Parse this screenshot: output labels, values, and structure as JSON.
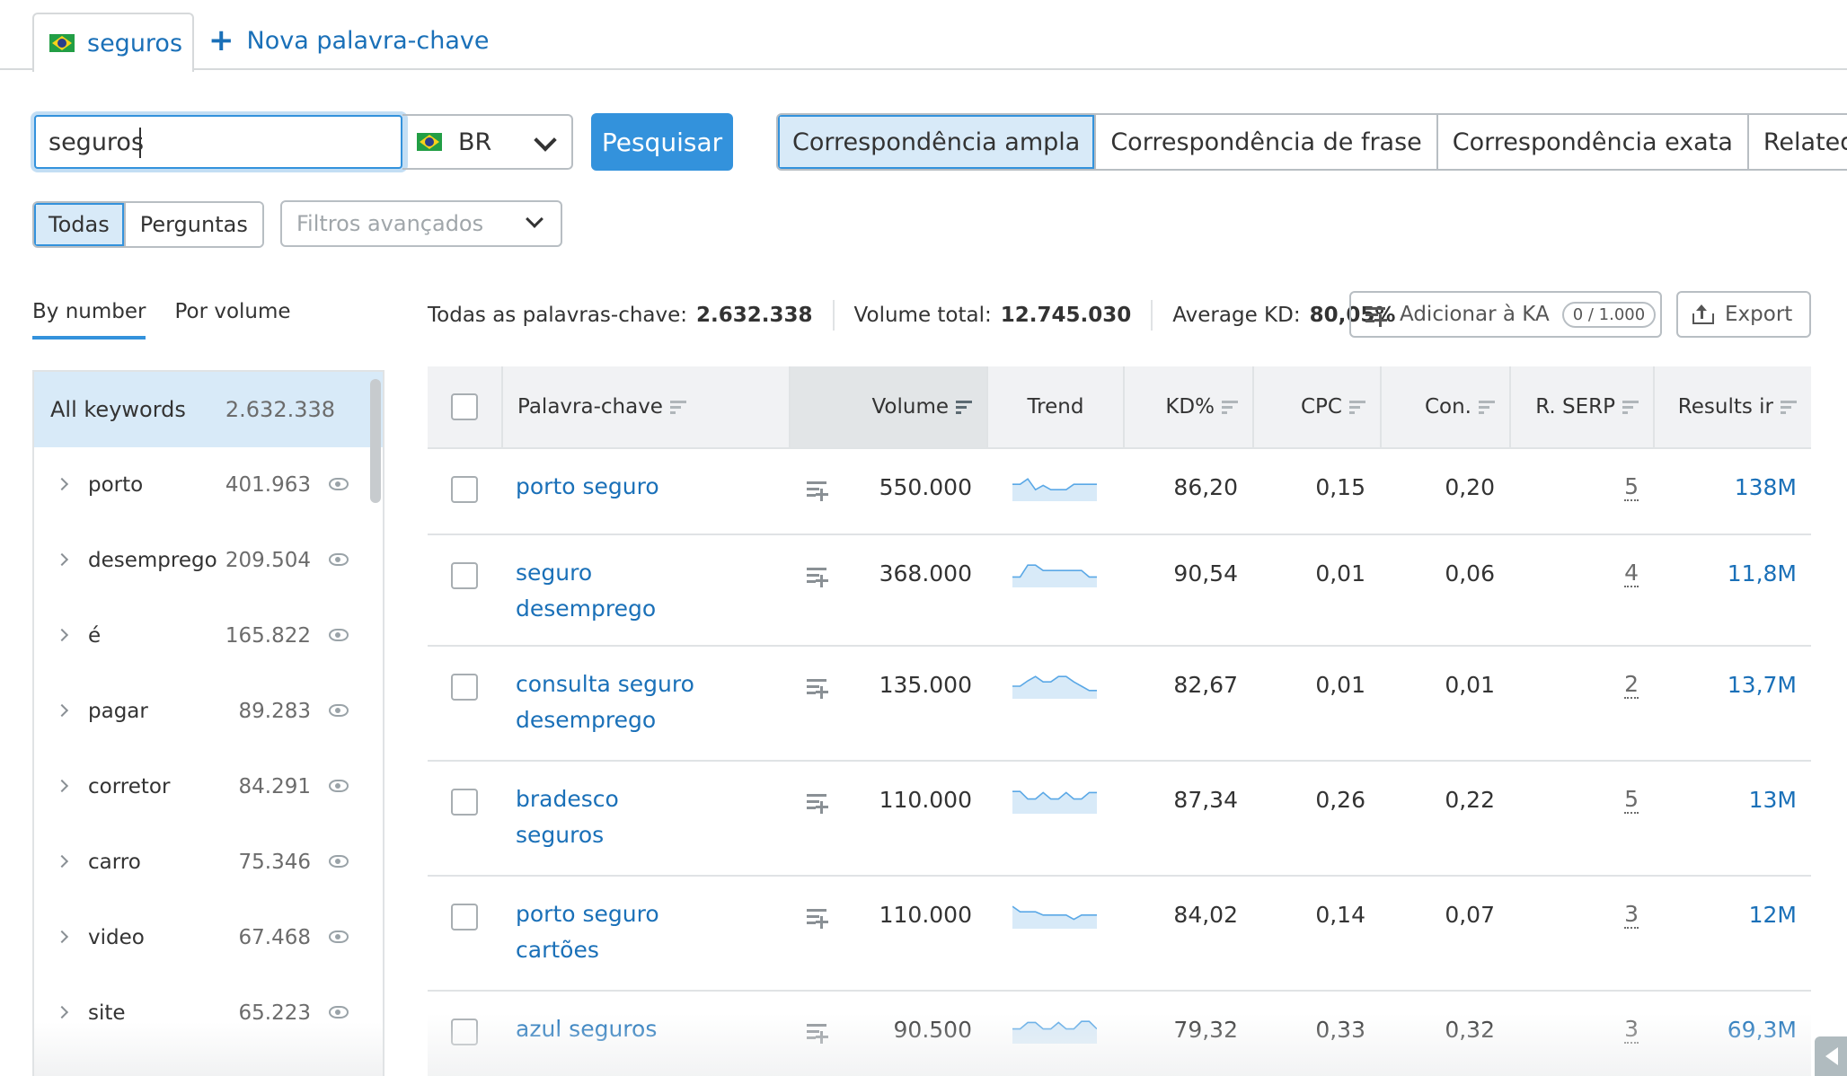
{
  "tabs": {
    "active_label": "seguros",
    "new_keyword_label": "Nova palavra-chave"
  },
  "search": {
    "value": "seguros",
    "country": "BR",
    "submit_label": "Pesquisar"
  },
  "match_types": [
    {
      "label": "Correspondência ampla",
      "active": true
    },
    {
      "label": "Correspondência de frase",
      "active": false
    },
    {
      "label": "Correspondência exata",
      "active": false
    },
    {
      "label": "Related",
      "active": false
    }
  ],
  "question_filter": [
    {
      "label": "Todas",
      "active": true
    },
    {
      "label": "Perguntas",
      "active": false
    }
  ],
  "advanced_filters": {
    "placeholder": "Filtros avançados"
  },
  "groups": {
    "tabs": [
      {
        "label": "By number",
        "active": true
      },
      {
        "label": "Por volume",
        "active": false
      }
    ],
    "all": {
      "label": "All keywords",
      "count": "2.632.338"
    },
    "items": [
      {
        "name": "porto",
        "count": "401.963"
      },
      {
        "name": "desemprego",
        "count": "209.504"
      },
      {
        "name": "é",
        "count": "165.822"
      },
      {
        "name": "pagar",
        "count": "89.283"
      },
      {
        "name": "corretor",
        "count": "84.291"
      },
      {
        "name": "carro",
        "count": "75.346"
      },
      {
        "name": "video",
        "count": "67.468"
      },
      {
        "name": "site",
        "count": "65.223"
      }
    ]
  },
  "stats": {
    "all_keywords_label": "Todas as palavras-chave:",
    "all_keywords_value": "2.632.338",
    "total_volume_label": "Volume total:",
    "total_volume_value": "12.745.030",
    "avg_kd_label": "Average KD:",
    "avg_kd_value": "80,05%"
  },
  "actions": {
    "add_to_ka_label": "Adicionar à KA",
    "add_to_ka_badge": "0 / 1.000",
    "export_label": "Export"
  },
  "table": {
    "columns": {
      "keyword": "Palavra-chave",
      "volume": "Volume",
      "trend": "Trend",
      "kd": "KD%",
      "cpc": "CPC",
      "com": "Con.",
      "serp": "R. SERP",
      "results": "Results ir"
    },
    "sorted_by": "volume",
    "trend_color": "#5aa8e6",
    "trend_fill": "#d8eaf8",
    "rows": [
      {
        "keyword": "porto seguro",
        "volume": "550.000",
        "kd": "86,20",
        "cpc": "0,15",
        "com": "0,20",
        "serp": "5",
        "results": "138M",
        "trend": [
          0.7,
          0.7,
          0.95,
          0.45,
          0.65,
          0.45,
          0.45,
          0.45,
          0.7,
          0.7,
          0.7,
          0.7
        ]
      },
      {
        "keyword": "seguro desemprego",
        "volume": "368.000",
        "kd": "90,54",
        "cpc": "0,01",
        "com": "0,06",
        "serp": "4",
        "results": "11,8M",
        "trend": [
          0.4,
          0.4,
          0.95,
          0.95,
          0.7,
          0.7,
          0.7,
          0.7,
          0.7,
          0.7,
          0.4,
          0.4
        ]
      },
      {
        "keyword": "consulta seguro desemprego",
        "volume": "135.000",
        "kd": "82,67",
        "cpc": "0,01",
        "com": "0,01",
        "serp": "2",
        "results": "13,7M",
        "trend": [
          0.5,
          0.5,
          0.75,
          0.95,
          0.7,
          0.7,
          0.95,
          0.95,
          0.7,
          0.5,
          0.3,
          0.3
        ]
      },
      {
        "keyword": "bradesco seguros",
        "volume": "110.000",
        "kd": "87,34",
        "cpc": "0,26",
        "com": "0,22",
        "serp": "5",
        "results": "13M",
        "trend": [
          0.95,
          0.95,
          0.6,
          0.6,
          0.9,
          0.6,
          0.6,
          0.9,
          0.6,
          0.6,
          0.9,
          0.9
        ]
      },
      {
        "keyword": "porto seguro cartões",
        "volume": "110.000",
        "kd": "84,02",
        "cpc": "0,14",
        "com": "0,07",
        "serp": "3",
        "results": "12M",
        "trend": [
          0.95,
          0.7,
          0.7,
          0.7,
          0.55,
          0.55,
          0.55,
          0.55,
          0.35,
          0.55,
          0.55,
          0.55
        ]
      },
      {
        "keyword": "azul seguros",
        "volume": "90.500",
        "kd": "79,32",
        "cpc": "0,33",
        "com": "0,32",
        "serp": "3",
        "results": "69,3M",
        "trend": [
          0.6,
          0.6,
          0.9,
          0.9,
          0.6,
          0.6,
          0.9,
          0.6,
          0.6,
          0.95,
          0.95,
          0.6
        ]
      }
    ]
  }
}
